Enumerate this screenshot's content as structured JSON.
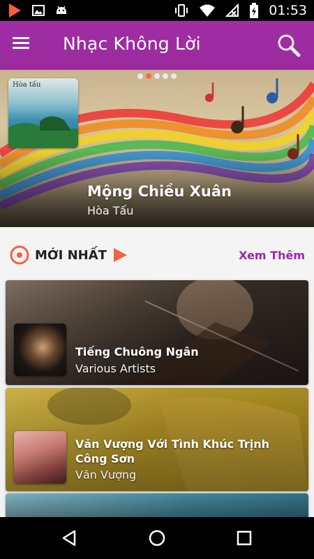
{
  "status_bar": {
    "time": "01:53",
    "icons": [
      "play-store-icon",
      "image-icon",
      "android-icon",
      "vibrate-icon",
      "wifi-icon",
      "no-signal-icon",
      "battery-charging-icon"
    ]
  },
  "app_bar": {
    "title": "Nhạc Không Lời",
    "menu_icon": "hamburger-menu-icon",
    "search_icon": "search-icon",
    "color": "#9c27b0"
  },
  "banner": {
    "title": "Mộng Chiều Xuân",
    "artist": "Hòa Tấu",
    "cover_text": "Hòa tấu",
    "carousel": {
      "count": 5,
      "active_index": 1
    }
  },
  "section": {
    "title": "MỚI NHẤT",
    "see_more": "Xem Thêm",
    "accent": "#f4633f"
  },
  "songs": [
    {
      "title": "Tiếng Chuông Ngân",
      "artist": "Various Artists"
    },
    {
      "title": "Văn Vượng Với Tình Khúc Trịnh Công Sơn",
      "artist": "Văn Vượng"
    }
  ],
  "nav_bar": {
    "icons": [
      "back-icon",
      "home-icon",
      "recents-icon"
    ]
  }
}
